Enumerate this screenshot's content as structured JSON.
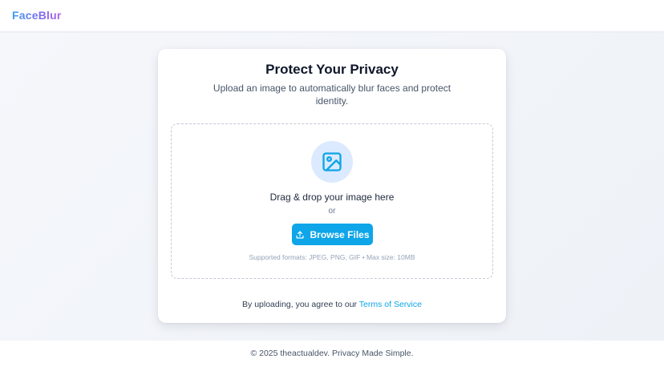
{
  "header": {
    "logo": "FaceBlur"
  },
  "card": {
    "title": "Protect Your Privacy",
    "subtitle": "Upload an image to automatically blur faces and protect identity.",
    "dropzone": {
      "icon": "image-icon",
      "drag_text": "Drag & drop your image here",
      "or_text": "or",
      "browse_label": "Browse Files",
      "browse_icon": "upload-icon",
      "formats": "Supported formats: JPEG, PNG, GIF • Max size: 10MB"
    },
    "terms_prefix": "By uploading, you agree to our ",
    "terms_link": "Terms of Service"
  },
  "footer": {
    "text": "© 2025 theactualdev. Privacy Made Simple."
  },
  "colors": {
    "accent": "#0ea5e9",
    "icon_bg": "#dbeafe",
    "logo_gradient_start": "#3aa0f0",
    "logo_gradient_end": "#b45fe6"
  }
}
